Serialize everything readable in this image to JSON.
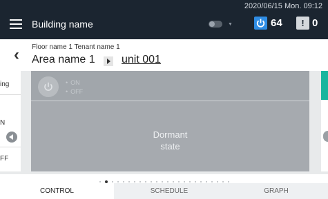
{
  "header": {
    "building_name": "Building name",
    "datetime": "2020/06/15 Mon. 09:12",
    "power_count": "64",
    "alert_count": "0",
    "alert_symbol": "!"
  },
  "location": {
    "breadcrumb": "Floor name 1 Tenant name 1",
    "area_name": "Area name 1",
    "unit_name": "unit 001"
  },
  "left_card": {
    "text_top": "ing",
    "text_mid": "N",
    "text_bottom": "FF"
  },
  "card": {
    "on_label": "ON",
    "off_label": "OFF",
    "state_line1": "Dormant",
    "state_line2": "state"
  },
  "tabs": [
    {
      "label": "CONTROL",
      "active": true
    },
    {
      "label": "SCHEDULE",
      "active": false
    },
    {
      "label": "GRAPH",
      "active": false
    }
  ],
  "pagination": {
    "total": 24,
    "active_index": 1
  },
  "colors": {
    "topbar": "#1b2530",
    "power_badge": "#2f8de4",
    "accent_teal": "#19b59e",
    "card_gray": "#a6aaaf"
  },
  "icons": {
    "menu": "hamburger-icon",
    "back": "chevron-left-icon",
    "power": "power-icon",
    "alert": "warning-icon"
  }
}
